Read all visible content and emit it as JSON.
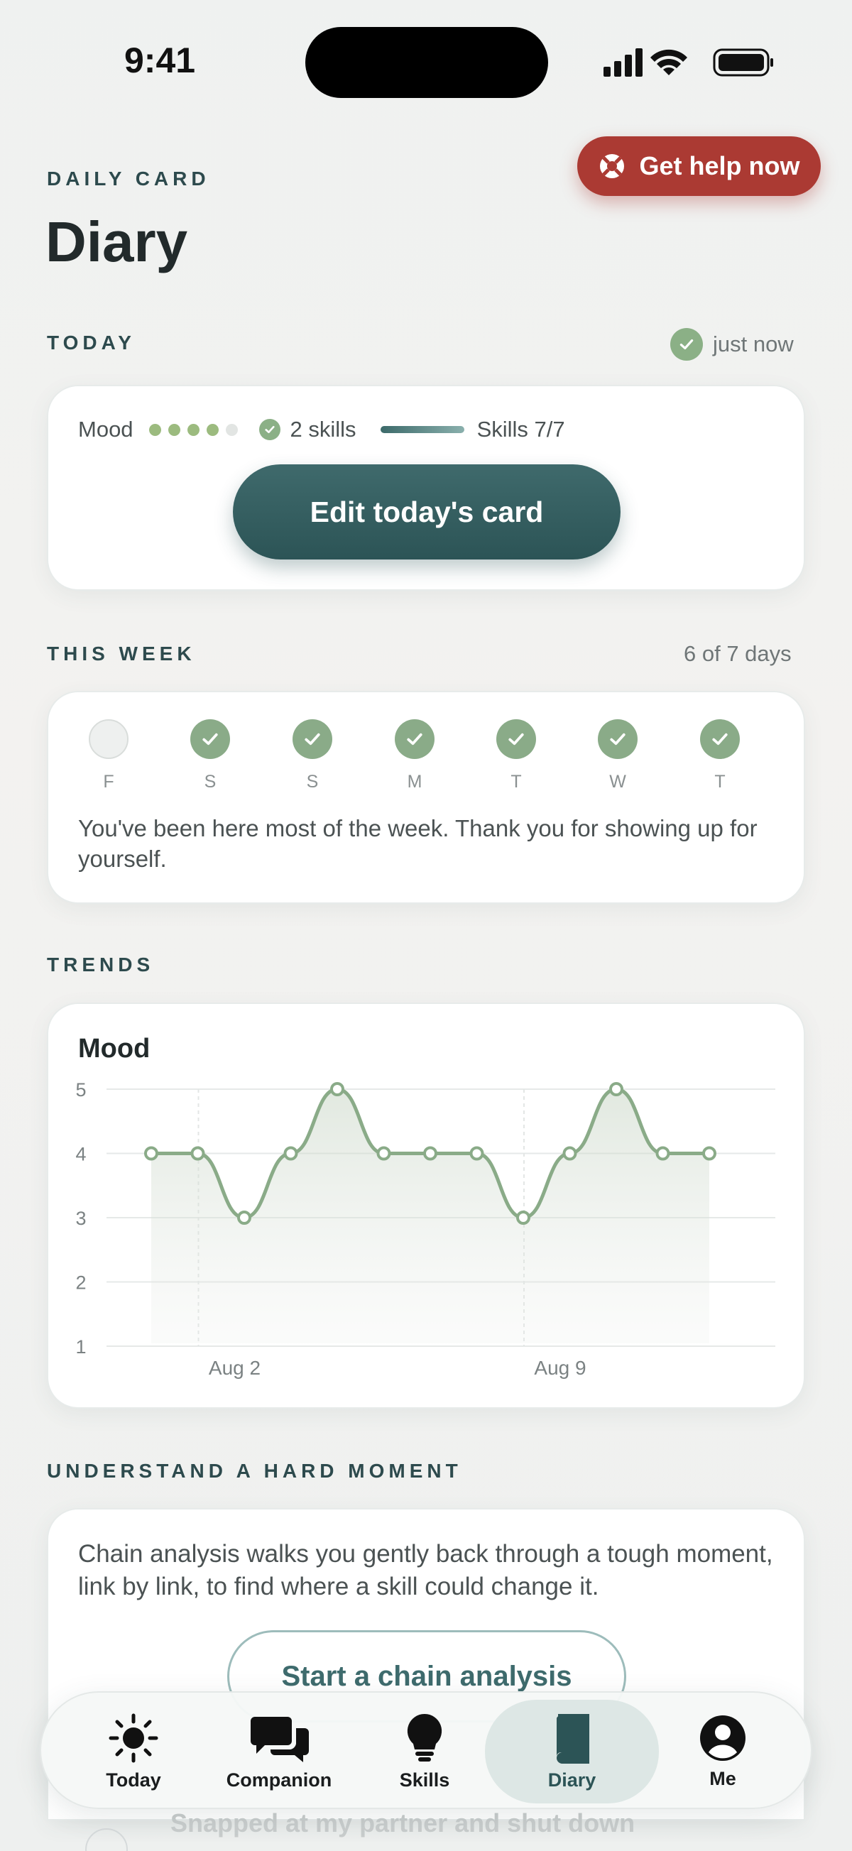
{
  "status_bar": {
    "time": "9:41"
  },
  "header": {
    "kicker": "DAILY CARD",
    "title": "Diary",
    "help_label": "Get help now"
  },
  "today": {
    "section": "TODAY",
    "saved": "just now",
    "mood_label": "Mood",
    "mood_dots": 4,
    "mood_dots_total": 5,
    "skills_count": "2 skills",
    "skills_progress_label": "Skills 7/7",
    "edit_label": "Edit today's card"
  },
  "week": {
    "section": "THIS WEEK",
    "summary": "6 of 7 days",
    "days": [
      {
        "label": "F",
        "done": false
      },
      {
        "label": "S",
        "done": true
      },
      {
        "label": "S",
        "done": true
      },
      {
        "label": "M",
        "done": true
      },
      {
        "label": "T",
        "done": true
      },
      {
        "label": "W",
        "done": true
      },
      {
        "label": "T",
        "done": true
      }
    ],
    "message": "You've been here most of the week. Thank you for showing up for yourself."
  },
  "trends": {
    "section": "TRENDS"
  },
  "chart_data": {
    "type": "line",
    "title": "Mood",
    "x_labels": [
      "Aug 2",
      "Aug 9"
    ],
    "x": [
      "Aug 1",
      "Aug 2",
      "Aug 3",
      "Aug 4",
      "Aug 5",
      "Aug 6",
      "Aug 7",
      "Aug 8",
      "Aug 9",
      "Aug 10",
      "Aug 11",
      "Aug 12",
      "Aug 13"
    ],
    "values": [
      4,
      4,
      3,
      4,
      5,
      4,
      4,
      4,
      3,
      4,
      5,
      4,
      4
    ],
    "ylim": [
      1,
      5
    ],
    "yticks": [
      1,
      2,
      3,
      4,
      5
    ],
    "grid": true,
    "color": "#8aab88"
  },
  "chain": {
    "section": "UNDERSTAND A HARD MOMENT",
    "description": "Chain analysis walks you gently back through a tough moment, link by link, to find where a skill could change it.",
    "button_label": "Start a chain analysis",
    "partial_entry": "Snapped at my partner and shut down"
  },
  "tabbar": {
    "items": [
      {
        "label": "Today",
        "icon": "sun-icon"
      },
      {
        "label": "Companion",
        "icon": "chat-bubbles-icon"
      },
      {
        "label": "Skills",
        "icon": "lightbulb-icon"
      },
      {
        "label": "Diary",
        "icon": "book-icon",
        "active": true
      },
      {
        "label": "Me",
        "icon": "person-icon"
      }
    ]
  },
  "colors": {
    "accent": "#2c5456",
    "danger": "#ab3a33",
    "success": "#8aab88"
  }
}
